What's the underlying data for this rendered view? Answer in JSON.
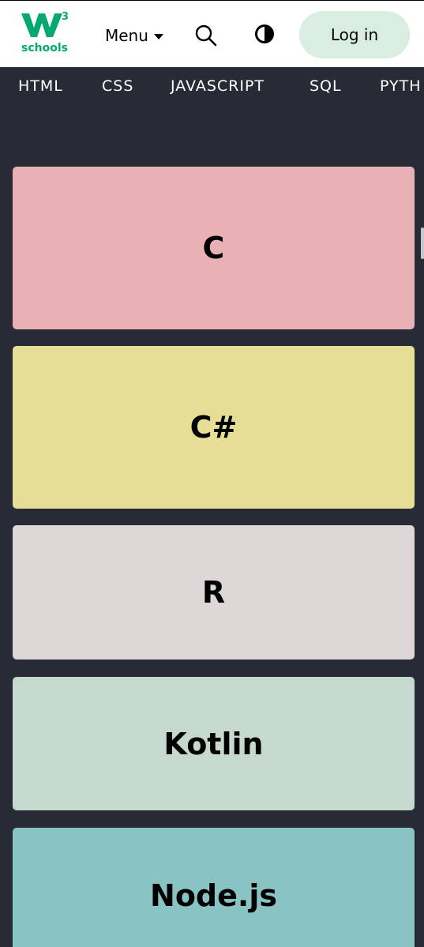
{
  "header": {
    "logo_text": "schools",
    "logo_superscript": "3",
    "menu_label": "Menu",
    "login_label": "Log in",
    "colors": {
      "brand": "#04aa6d",
      "login_bg": "#d9eee1"
    },
    "icons": [
      "search-icon",
      "contrast-icon",
      "caret-down-icon"
    ]
  },
  "nav": {
    "items": [
      "HTML",
      "CSS",
      "JAVASCRIPT",
      "SQL",
      "PYTH"
    ]
  },
  "cards": [
    {
      "label": "C",
      "color": "#e7b1b6"
    },
    {
      "label": "C#",
      "color": "#e7de96"
    },
    {
      "label": "R",
      "color": "#ddd7d8"
    },
    {
      "label": "Kotlin",
      "color": "#c5d9cf"
    },
    {
      "label": "Node.js",
      "color": "#8ac3c3"
    }
  ],
  "page": {
    "background": "#282a35"
  }
}
